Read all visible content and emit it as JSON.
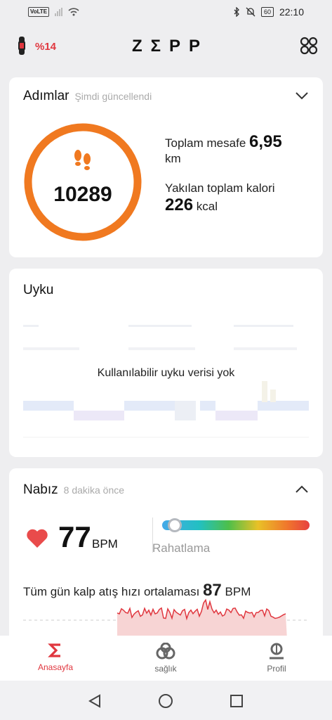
{
  "status_bar": {
    "network_badge": "VoLTE",
    "battery": "60",
    "time": "22:10"
  },
  "header": {
    "band_battery": "%14",
    "logo": "ZΣPP"
  },
  "steps_card": {
    "title": "Adımlar",
    "subtitle": "Şimdi güncellendi",
    "steps": "10289",
    "distance_label": "Toplam mesafe",
    "distance_value": "6,95",
    "distance_unit": "km",
    "calories_label": "Yakılan toplam kalori",
    "calories_value": "226",
    "calories_unit": "kcal",
    "ring_color": "#f07920"
  },
  "sleep_card": {
    "title": "Uyku",
    "empty_message": "Kullanılabilir uyku verisi yok"
  },
  "heart_card": {
    "title": "Nabız",
    "subtitle": "8 dakika önce",
    "bpm": "77",
    "bpm_unit": "BPM",
    "zone": "Rahatlama",
    "zone_level": 0.04,
    "avg_label": "Tüm gün kalp atış hızı ortalaması",
    "avg_value": "87",
    "avg_unit": "BPM",
    "heart_color": "#e94b4b"
  },
  "bottom_nav": {
    "items": [
      {
        "label": "Anasayfa",
        "icon": "sigma-icon",
        "active": true
      },
      {
        "label": "sağlık",
        "icon": "health-icon",
        "active": false
      },
      {
        "label": "Profil",
        "icon": "profile-icon",
        "active": false
      }
    ]
  },
  "accent_color": "#e0373f"
}
